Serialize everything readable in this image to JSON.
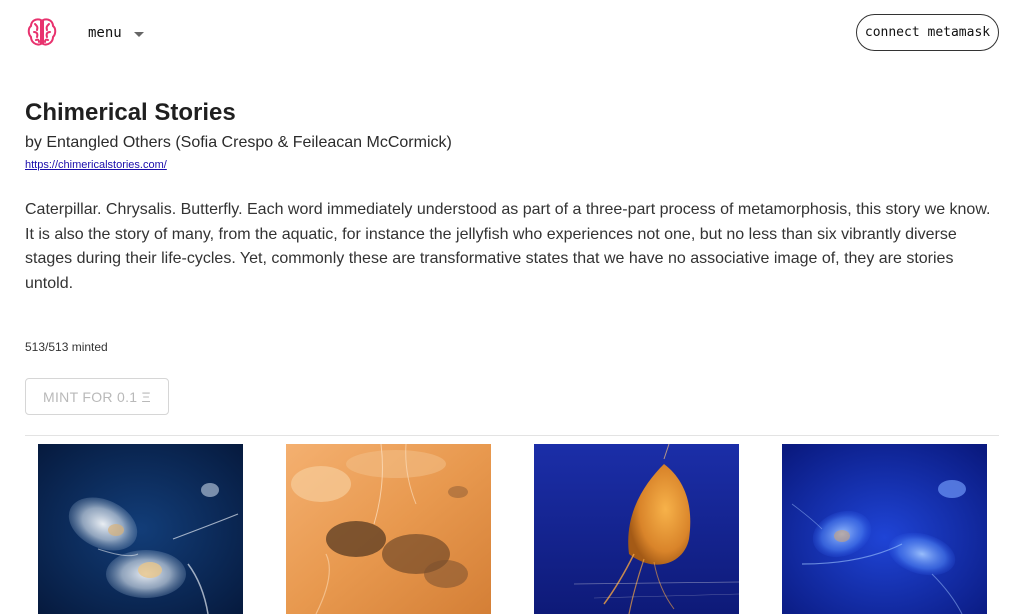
{
  "header": {
    "logo_icon": "brain-icon",
    "menu_label": "menu",
    "menu_icon": "caret-down-icon",
    "connect_label": "connect metamask"
  },
  "project": {
    "title": "Chimerical Stories",
    "byline": "by Entangled Others (Sofia Crespo & Feileacan McCormick)",
    "link": "https://chimericalstories.com/",
    "description": "Caterpillar. Chrysalis. Butterfly. Each word immediately understood as part of a three-part process of metamorphosis, this story we know. It is also the story of many, from the aquatic, for instance the jellyfish who experiences not one, but no less than six vibrantly diverse stages during their life-cycles. Yet, commonly these are transformative states that we have no associative image of, they are stories untold.",
    "minted": "513/513 minted",
    "mint_label": "MINT FOR 0.1 Ξ"
  },
  "colors": {
    "logo": "#e8326e",
    "link": "#1a0dab",
    "disabled_text": "#b9b9b9"
  },
  "gallery": [
    {
      "subject": "translucent jellyfish on deep blue"
    },
    {
      "subject": "amber organic forms on orange"
    },
    {
      "subject": "orange creature on royal blue"
    },
    {
      "subject": "glowing blue jellyfish"
    }
  ]
}
